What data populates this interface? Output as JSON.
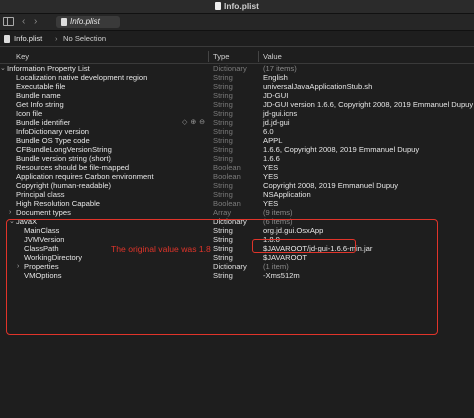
{
  "window": {
    "title": "Info.plist"
  },
  "tabbar": {
    "tab_label": "Info.plist",
    "back_glyph": "‹",
    "forward_glyph": "›"
  },
  "pathbar": {
    "file": "Info.plist",
    "separator": "›",
    "selection": "No Selection"
  },
  "columns": {
    "key": "Key",
    "type": "Type",
    "value": "Value"
  },
  "rows": [
    {
      "key": "Information Property List",
      "type": "Dictionary",
      "value": "(17 items)",
      "indent": 0,
      "disclosure": "open",
      "type_dim": true,
      "value_dim": true
    },
    {
      "key": "Localization native development region",
      "type": "String",
      "value": "English",
      "indent": 1,
      "type_dim": true
    },
    {
      "key": "Executable file",
      "type": "String",
      "value": "universalJavaApplicationStub.sh",
      "indent": 1,
      "type_dim": true
    },
    {
      "key": "Bundle name",
      "type": "String",
      "value": "JD-GUI",
      "indent": 1,
      "type_dim": true
    },
    {
      "key": "Get Info string",
      "type": "String",
      "value": "JD-GUI version 1.6.6, Copyright 2008, 2019 Emmanuel Dupuy",
      "indent": 1,
      "type_dim": true
    },
    {
      "key": "Icon file",
      "type": "String",
      "value": "jd-gui.icns",
      "indent": 1,
      "type_dim": true
    },
    {
      "key": "Bundle identifier",
      "type": "String",
      "value": "jd.jd-gui",
      "indent": 1,
      "type_dim": true,
      "stepper": "◇ ⊕ ⊖"
    },
    {
      "key": "InfoDictionary version",
      "type": "String",
      "value": "6.0",
      "indent": 1,
      "type_dim": true
    },
    {
      "key": "Bundle OS Type code",
      "type": "String",
      "value": "APPL",
      "indent": 1,
      "type_dim": true
    },
    {
      "key": "CFBundleLongVersionString",
      "type": "String",
      "value": "1.6.6, Copyright 2008, 2019 Emmanuel Dupuy",
      "indent": 1,
      "type_dim": true
    },
    {
      "key": "Bundle version string (short)",
      "type": "String",
      "value": "1.6.6",
      "indent": 1,
      "type_dim": true
    },
    {
      "key": "Resources should be file-mapped",
      "type": "Boolean",
      "value": "YES",
      "indent": 1,
      "type_dim": true
    },
    {
      "key": "Application requires Carbon environment",
      "type": "Boolean",
      "value": "YES",
      "indent": 1,
      "type_dim": true
    },
    {
      "key": "Copyright (human-readable)",
      "type": "String",
      "value": "Copyright 2008, 2019 Emmanuel Dupuy",
      "indent": 1,
      "type_dim": true
    },
    {
      "key": "Principal class",
      "type": "String",
      "value": "NSApplication",
      "indent": 1,
      "type_dim": true
    },
    {
      "key": "High Resolution Capable",
      "type": "Boolean",
      "value": "YES",
      "indent": 1,
      "type_dim": true
    },
    {
      "key": "Document types",
      "type": "Array",
      "value": "(9 items)",
      "indent": 1,
      "disclosure": "closed",
      "type_dim": true,
      "value_dim": true
    },
    {
      "key": "JavaX",
      "type": "Dictionary",
      "value": "(6 items)",
      "indent": 1,
      "disclosure": "open",
      "value_dim": true
    },
    {
      "key": "MainClass",
      "type": "String",
      "value": "org.jd.gui.OsxApp",
      "indent": 2
    },
    {
      "key": "JVMVersion",
      "type": "String",
      "value": "1.8.0",
      "indent": 2
    },
    {
      "key": "ClassPath",
      "type": "String",
      "value": "$JAVAROOT/jd-gui-1.6.6-min.jar",
      "indent": 2
    },
    {
      "key": "WorkingDirectory",
      "type": "String",
      "value": "$JAVAROOT",
      "indent": 2
    },
    {
      "key": "Properties",
      "type": "Dictionary",
      "value": "(1 item)",
      "indent": 2,
      "disclosure": "closed",
      "value_dim": true
    },
    {
      "key": "VMOptions",
      "type": "String",
      "value": "-Xms512m",
      "indent": 2
    }
  ],
  "annotation": {
    "text": "The original value was  1.8"
  },
  "colors": {
    "annotation_red": "#e0342a",
    "background": "#1e1e1e"
  }
}
